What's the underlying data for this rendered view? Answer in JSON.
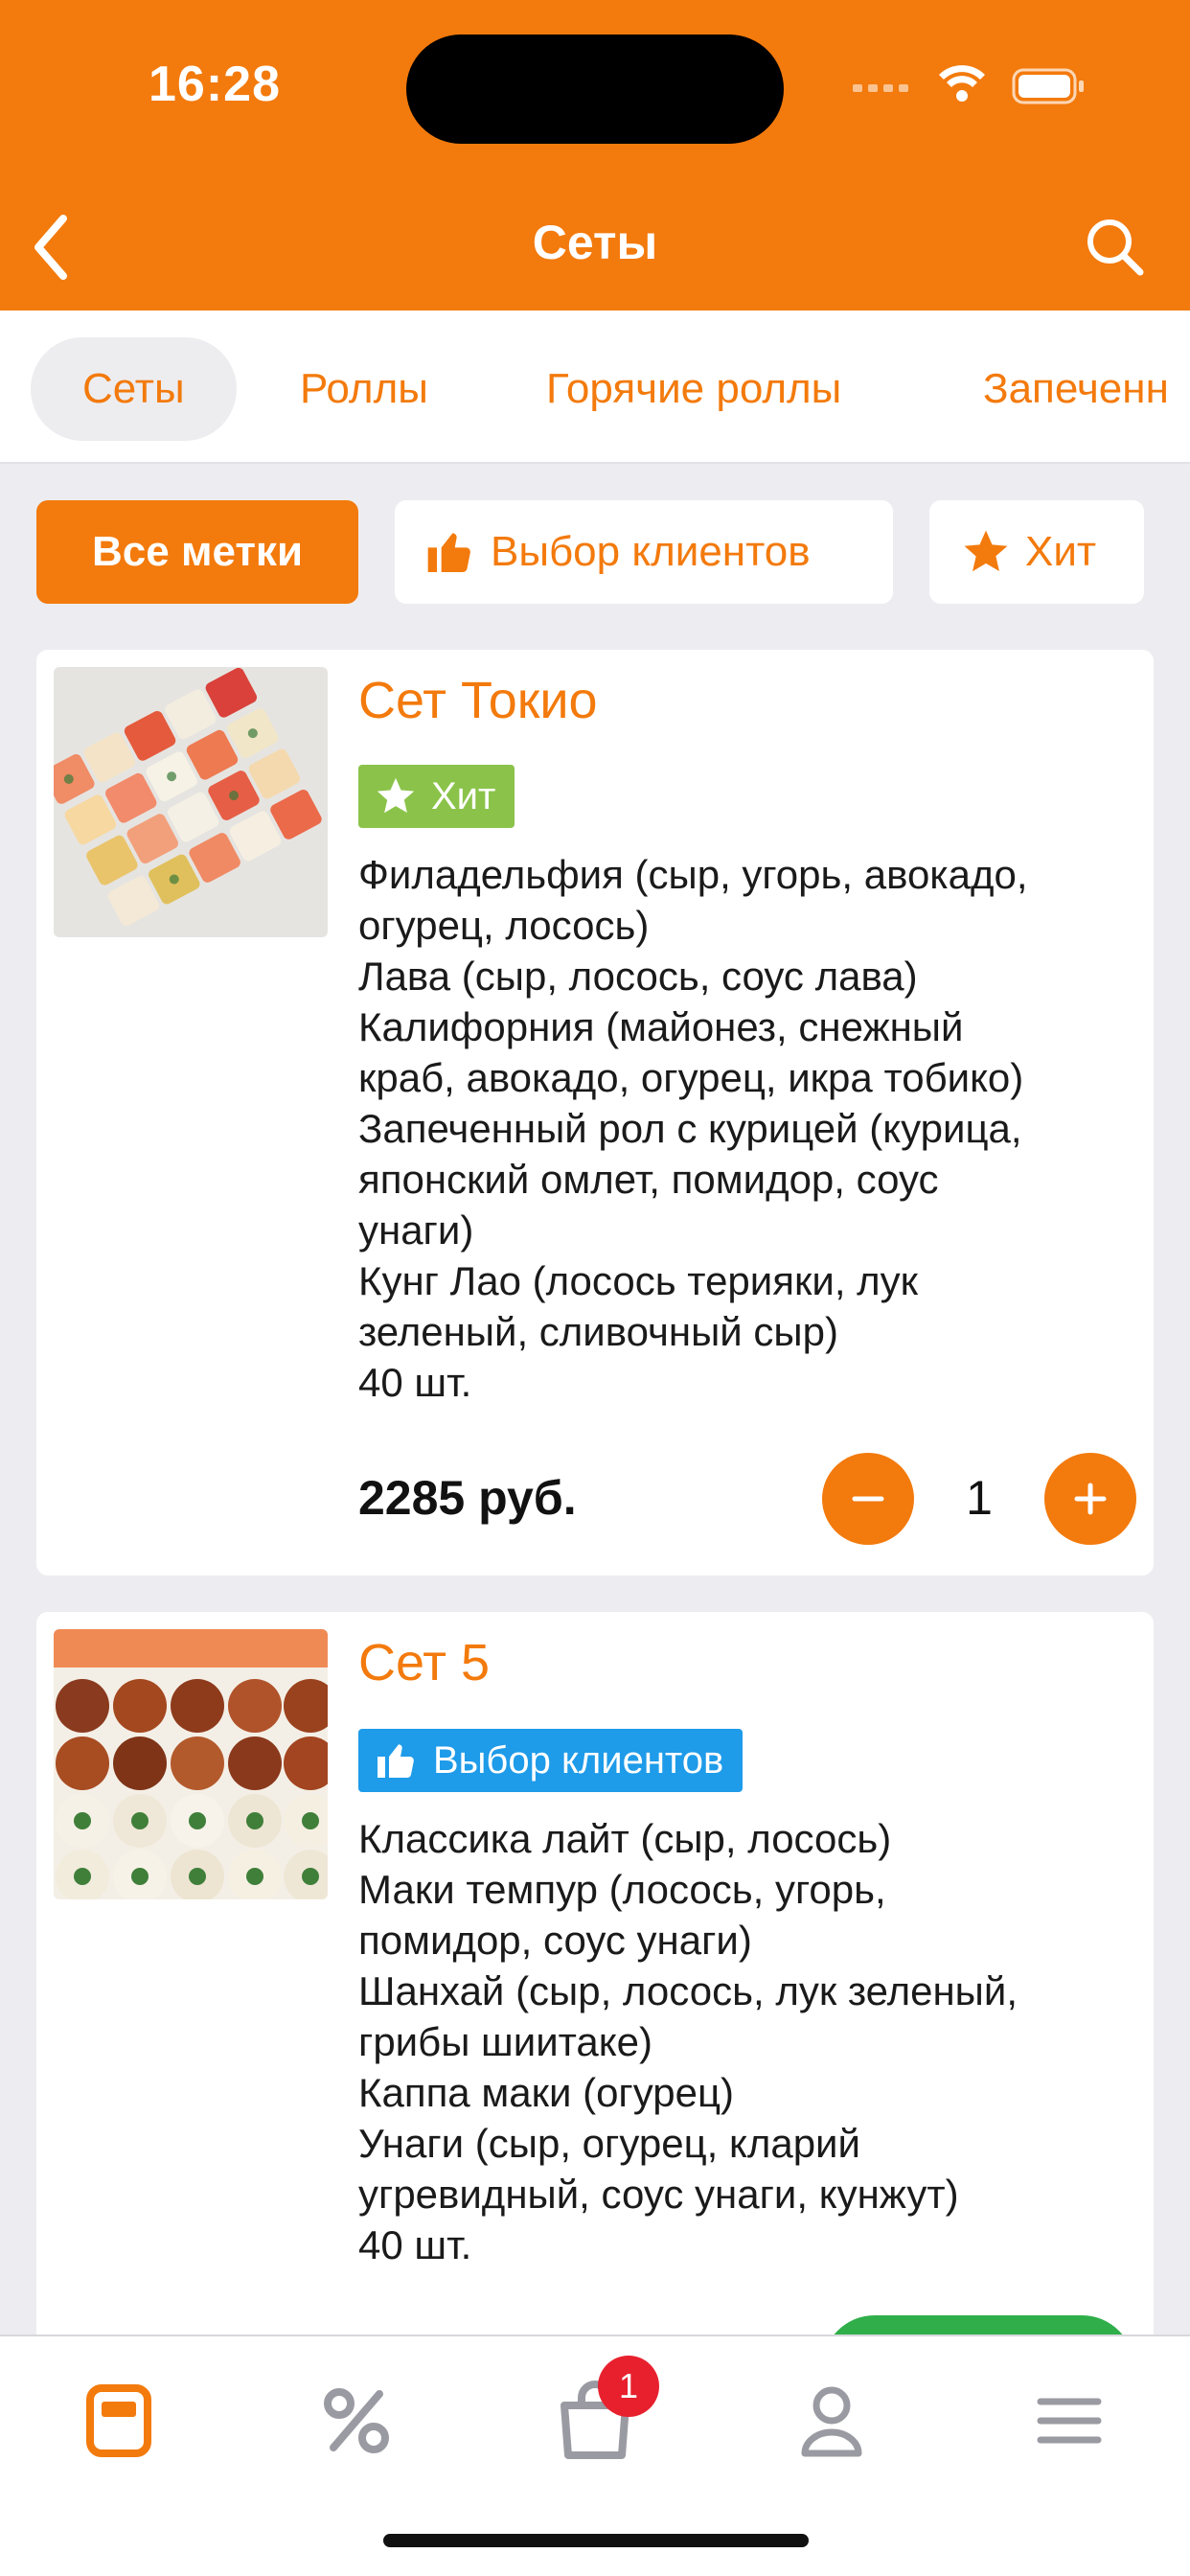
{
  "status": {
    "time": "16:28"
  },
  "nav": {
    "title": "Сеты"
  },
  "tabs": [
    {
      "label": "Сеты"
    },
    {
      "label": "Роллы"
    },
    {
      "label": "Горячие роллы"
    },
    {
      "label": "Запеченн"
    }
  ],
  "filters": [
    {
      "label": "Все метки"
    },
    {
      "label": "Выбор клиентов"
    },
    {
      "label": "Хит"
    }
  ],
  "products": [
    {
      "title": "Сет Токио",
      "badge": "Хит",
      "lines": [
        "Филадельфия (сыр, угорь, авокадо,",
        "огурец, лосось)",
        "Лава (сыр, лосось, соус лава)",
        "Калифорния (майонез, снежный",
        "краб, авокадо, огурец, икра тобико)",
        "Запеченный рол с курицей (курица,",
        "японский омлет, помидор, соус",
        "унаги)",
        "Кунг Лао (лосось терияки, лук",
        "зеленый, сливочный сыр)",
        "40 шт."
      ],
      "price": "2285 руб.",
      "quantity": "1"
    },
    {
      "title": "Сет 5",
      "badge": "Выбор клиентов",
      "lines": [
        "Классика лайт (сыр, лосось)",
        "Маки темпур (лосось, угорь,",
        "помидор, соус унаги)",
        "Шанхай (сыр, лосось, лук зеленый,",
        "грибы шиитаке)",
        "Каппа маки (огурец)",
        "Унаги (сыр, огурец, кларий",
        "угревидный, соус унаги, кунжут)",
        "40 шт."
      ]
    }
  ],
  "tabbar": {
    "cart_count": "1"
  },
  "colors": {
    "accent": "#F37A0C",
    "hit": "#8BC34A",
    "choice": "#1E9BE9",
    "add": "#2FAE4A",
    "badge": "#E8202E"
  }
}
